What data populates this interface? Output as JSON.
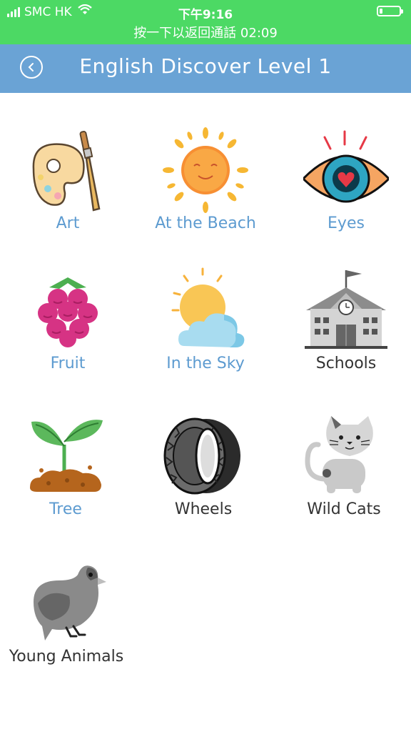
{
  "status_bar": {
    "carrier": "SMC HK",
    "time": "下午9:16",
    "call_banner": "按一下以返回通話 02:09"
  },
  "header": {
    "title": "English Discover Level 1"
  },
  "topics": [
    {
      "label": "Art",
      "icon": "palette-icon",
      "color": "#5d9bd0"
    },
    {
      "label": "At the Beach",
      "icon": "sun-icon",
      "color": "#5d9bd0"
    },
    {
      "label": "Eyes",
      "icon": "eye-icon",
      "color": "#5d9bd0"
    },
    {
      "label": "Fruit",
      "icon": "raspberry-icon",
      "color": "#5d9bd0"
    },
    {
      "label": "In the Sky",
      "icon": "sun-cloud-icon",
      "color": "#5d9bd0"
    },
    {
      "label": "Schools",
      "icon": "school-icon",
      "color": "#333333"
    },
    {
      "label": "Tree",
      "icon": "sprout-icon",
      "color": "#5d9bd0"
    },
    {
      "label": "Wheels",
      "icon": "tire-icon",
      "color": "#333333"
    },
    {
      "label": "Wild Cats",
      "icon": "cat-icon",
      "color": "#333333"
    },
    {
      "label": "Young Animals",
      "icon": "bird-icon",
      "color": "#333333"
    }
  ]
}
